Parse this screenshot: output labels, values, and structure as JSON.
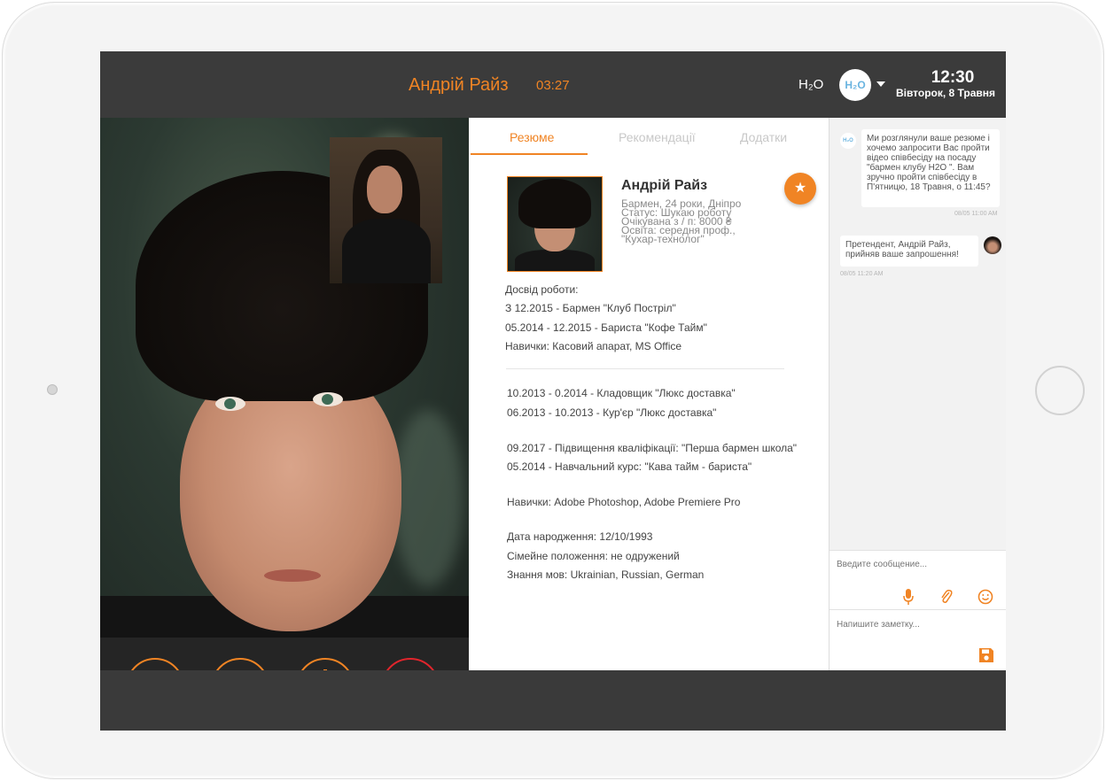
{
  "header": {
    "caller_name": "Андрій Райз",
    "call_time": "03:27",
    "brand": "H₂O",
    "avatar_text": "H₂O",
    "clock": "12:30",
    "date": "Вівторок, 8 Травня"
  },
  "tabs": [
    {
      "label": "Резюме",
      "active": true
    },
    {
      "label": "Рекомендації",
      "active": false
    },
    {
      "label": "Додатки",
      "active": false
    }
  ],
  "resume": {
    "name": "Андрій Райз",
    "info": [
      "Бармен, 24 роки, Дніпро",
      "Статус: Шукаю роботу",
      "Очікувана з / п: 8000 ₴",
      "Освіта: середня проф.,",
      "\"Кухар-технолог\""
    ],
    "lines": [
      "Досвід роботи:",
      "З 12.2015 - Бармен \"Клуб Постріл\"",
      "05.2014 - 12.2015 - Бариста \"Кофе Тайм\"",
      "Навички: Касовий апарат, MS Office",
      "10.2013 - 0.2014 - Кладовщик \"Люкс доставка\"",
      "06.2013 - 10.2013 - Кур'єр \"Люкс доставка\"",
      "09.2017 - Підвищення кваліфікації: \"Перша бармен школа\"",
      "05.2014 - Навчальний курс: \"Кава тайм - бариста\"",
      "Навички: Adobe Photoshop, Adobe Premiere Pro",
      "Дата народження: 12/10/1993",
      "Сімейне положення: не одружений",
      "Знання мов: Ukrainian, Russian, German"
    ]
  },
  "chat": {
    "messages": [
      {
        "text": "Ми розглянули ваше резюме і хочемо запросити Вас пройти відео співбесіду на посаду \"бармен клубу H2O \". Вам зручно пройти співбесіду в П'ятницю, 18 Травня, о 11:45?",
        "time": "08/05 11:00 AM"
      },
      {
        "text": "Претендент, Андрій Райз, прийняв ваше запрошення!",
        "time": "08/05 11:20 AM"
      }
    ],
    "message_placeholder": "Введите сообщение...",
    "note_placeholder": "Напишите заметку..."
  },
  "icons": {
    "accent": "#f08424",
    "end_call": "#e0252c",
    "controls": [
      "video-camera-icon",
      "microphone-icon",
      "plus-icon",
      "end-call-icon"
    ]
  }
}
